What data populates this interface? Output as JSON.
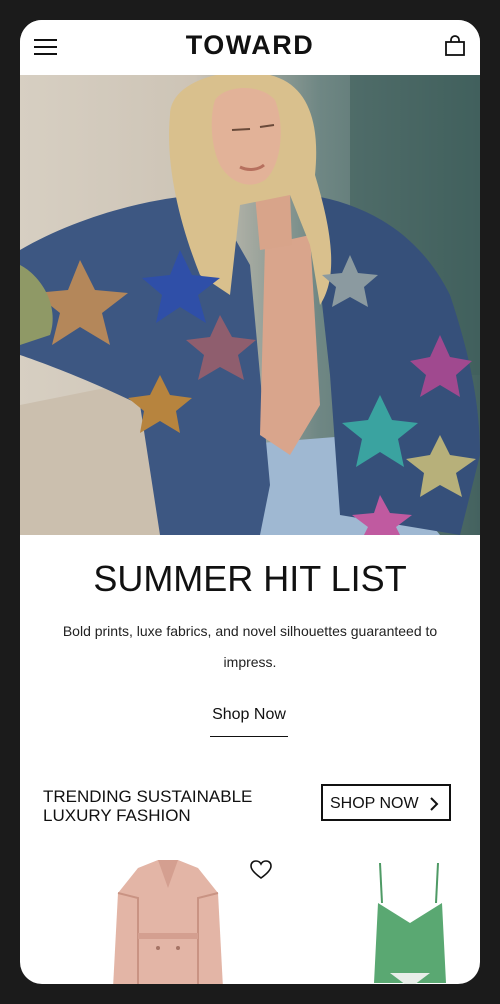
{
  "header": {
    "brand": "TOWARD",
    "menu_icon": "hamburger-menu-icon",
    "bag_icon": "shopping-bag-icon"
  },
  "hero": {
    "headline": "SUMMER HIT LIST",
    "description": "Bold prints, luxe fabrics, and novel silhouettes guaranteed to impress.",
    "cta_label": "Shop Now"
  },
  "trending": {
    "title": "TRENDING SUSTAINABLE LUXURY FASHION",
    "button_label": "SHOP NOW",
    "button_icon": "chevron-right-icon",
    "products": [
      {
        "icon": "heart-icon",
        "color": "#e3b5a6"
      },
      {
        "color": "#5aa872"
      }
    ]
  },
  "colors": {
    "background": "#1b1b1b",
    "text": "#111111",
    "surface": "#ffffff"
  }
}
